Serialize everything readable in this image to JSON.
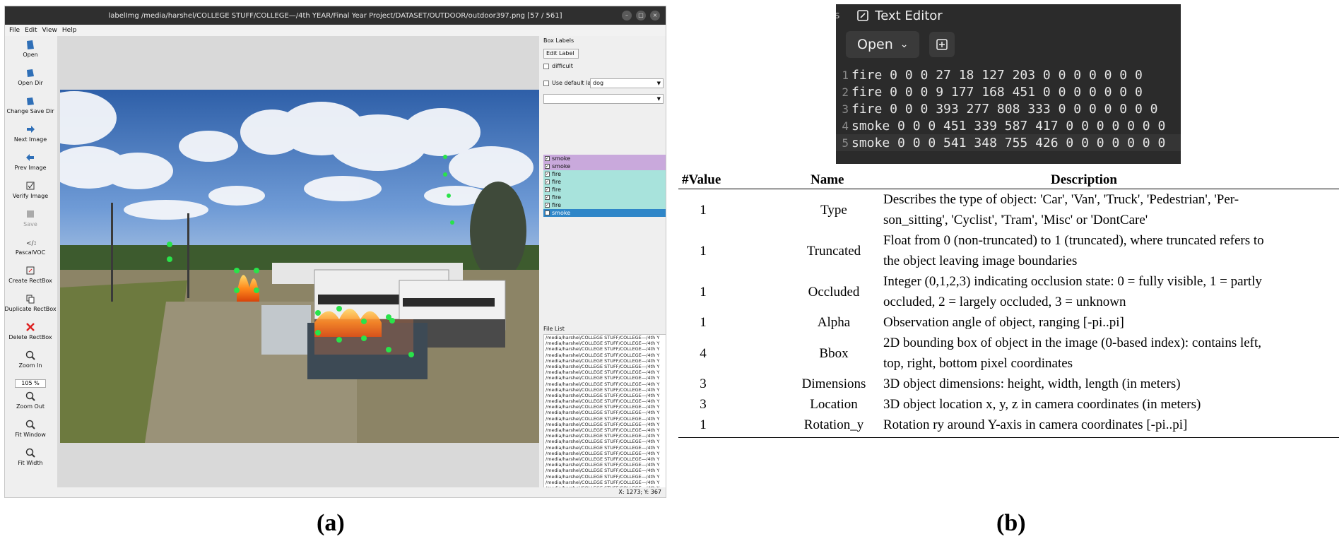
{
  "window": {
    "title": "labelImg /media/harshel/COLLEGE STUFF/COLLEGE—/4th YEAR/Final Year Project/DATASET/OUTDOOR/outdoor397.png [57 / 561]",
    "menu": [
      "File",
      "Edit",
      "View",
      "Help"
    ]
  },
  "toolbar": {
    "items": [
      {
        "label": "Open",
        "icon": "open-icon",
        "enabled": true
      },
      {
        "label": "Open Dir",
        "icon": "open-dir-icon",
        "enabled": true
      },
      {
        "label": "Change Save Dir",
        "icon": "change-save-dir-icon",
        "enabled": true
      },
      {
        "label": "Next Image",
        "icon": "next-arrow-icon",
        "enabled": true
      },
      {
        "label": "Prev Image",
        "icon": "prev-arrow-icon",
        "enabled": true
      },
      {
        "label": "Verify Image",
        "icon": "verify-icon",
        "enabled": true
      },
      {
        "label": "Save",
        "icon": "save-icon",
        "enabled": false
      },
      {
        "label": "PascalVOC",
        "icon": "format-icon",
        "enabled": true
      },
      {
        "label": "Create RectBox",
        "icon": "create-rect-icon",
        "enabled": true
      },
      {
        "label": "Duplicate RectBox",
        "icon": "duplicate-icon",
        "enabled": true
      },
      {
        "label": "Delete RectBox",
        "icon": "delete-x-icon",
        "enabled": true
      },
      {
        "label": "Zoom In",
        "icon": "zoom-in-icon",
        "enabled": true
      }
    ],
    "zoom_value": "105 %",
    "items_after": [
      {
        "label": "Zoom Out",
        "icon": "zoom-out-icon",
        "enabled": true
      },
      {
        "label": "Fit Window",
        "icon": "fit-window-icon",
        "enabled": true
      },
      {
        "label": "Fit Width",
        "icon": "fit-width-icon",
        "enabled": true
      }
    ]
  },
  "dock": {
    "box_labels_title": "Box Labels",
    "edit_label": "Edit Label",
    "difficult": "difficult",
    "use_default_label": "Use default label",
    "default_label_value": "dog",
    "labels": [
      {
        "text": "smoke",
        "color": "#c9a9dc"
      },
      {
        "text": "smoke",
        "color": "#c9a9dc"
      },
      {
        "text": "fire",
        "color": "#a8e3dc"
      },
      {
        "text": "fire",
        "color": "#a8e3dc"
      },
      {
        "text": "fire",
        "color": "#a8e3dc"
      },
      {
        "text": "fire",
        "color": "#a8e3dc"
      },
      {
        "text": "fire",
        "color": "#a8e3dc"
      },
      {
        "text": "smoke",
        "color": "#2f86c8"
      }
    ],
    "file_list_title": "File List",
    "file_row": "/media/harshel/COLLEGE STUFF/COLLEGE—/4th Y",
    "status": "X: 1273; Y: 367"
  },
  "captions": {
    "a": "(a)",
    "b": "(b)"
  },
  "text_editor": {
    "app_title": "Text Editor",
    "open_label": "Open",
    "lines": [
      {
        "num": "1",
        "text": "fire 0 0 0 27 18 127 203 0 0 0 0 0 0 0"
      },
      {
        "num": "2",
        "text": "fire 0 0 0 9 177 168 451 0 0 0 0 0 0 0"
      },
      {
        "num": "3",
        "text": "fire 0 0 0 393 277 808 333 0 0 0 0 0 0 0"
      },
      {
        "num": "4",
        "text": "smoke 0 0 0 451 339 587 417 0 0 0 0 0 0 0"
      },
      {
        "num": "5",
        "text": "smoke 0 0 0 541 348 755 426 0 0 0 0 0 0 0"
      }
    ]
  },
  "table": {
    "headers": [
      "#Value",
      "Name",
      "Description"
    ],
    "rows": [
      {
        "value": "1",
        "name": "Type",
        "desc": [
          "Describes the type of object: 'Car', 'Van', 'Truck', 'Pedestrian', 'Per-",
          "son_sitting', 'Cyclist', 'Tram', 'Misc' or 'DontCare'"
        ]
      },
      {
        "value": "1",
        "name": "Truncated",
        "desc": [
          "Float from 0 (non-truncated) to 1 (truncated), where truncated refers to",
          "the object leaving image boundaries"
        ]
      },
      {
        "value": "1",
        "name": "Occluded",
        "desc": [
          "Integer (0,1,2,3) indicating occlusion state: 0 = fully visible, 1 = partly",
          "occluded, 2 = largely occluded, 3 = unknown"
        ]
      },
      {
        "value": "1",
        "name": "Alpha",
        "desc": [
          "Observation angle of object, ranging [-pi..pi]"
        ]
      },
      {
        "value": "4",
        "name": "Bbox",
        "desc": [
          "2D bounding box of object in the image (0-based index): contains left,",
          "top, right, bottom pixel coordinates"
        ]
      },
      {
        "value": "3",
        "name": "Dimensions",
        "desc": [
          "3D object dimensions: height, width, length (in meters)"
        ]
      },
      {
        "value": "3",
        "name": "Location",
        "desc": [
          "3D object location x, y, z in camera coordinates (in meters)"
        ]
      },
      {
        "value": "1",
        "name": "Rotation_y",
        "desc": [
          "Rotation ry around Y-axis in camera coordinates [-pi..pi]"
        ]
      }
    ]
  }
}
